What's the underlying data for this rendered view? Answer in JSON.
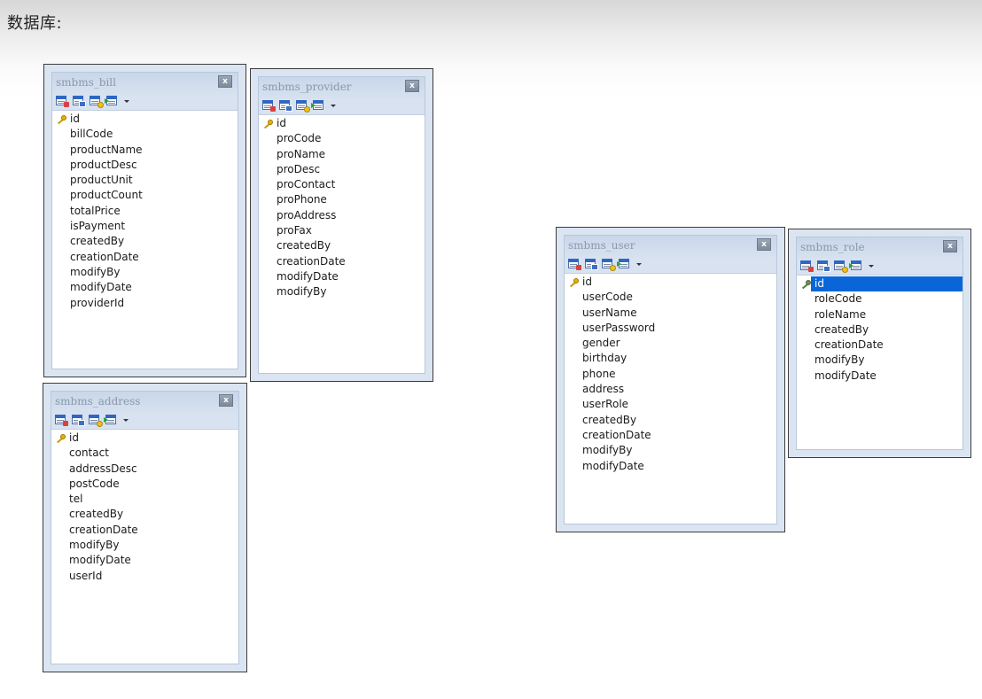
{
  "page": {
    "heading": "数据库:"
  },
  "tables": [
    {
      "name": "smbms_bill",
      "close_label": "x",
      "fields": [
        "id",
        "billCode",
        "productName",
        "productDesc",
        "productUnit",
        "productCount",
        "totalPrice",
        "isPayment",
        "createdBy",
        "creationDate",
        "modifyBy",
        "modifyDate",
        "providerId"
      ],
      "primary_key": "id",
      "selected_field": null
    },
    {
      "name": "smbms_provider",
      "close_label": "x",
      "fields": [
        "id",
        "proCode",
        "proName",
        "proDesc",
        "proContact",
        "proPhone",
        "proAddress",
        "proFax",
        "createdBy",
        "creationDate",
        "modifyDate",
        "modifyBy"
      ],
      "primary_key": "id",
      "selected_field": null
    },
    {
      "name": "smbms_address",
      "close_label": "x",
      "fields": [
        "id",
        "contact",
        "addressDesc",
        "postCode",
        "tel",
        "createdBy",
        "creationDate",
        "modifyBy",
        "modifyDate",
        "userId"
      ],
      "primary_key": "id",
      "selected_field": null
    },
    {
      "name": "smbms_user",
      "close_label": "x",
      "fields": [
        "id",
        "userCode",
        "userName",
        "userPassword",
        "gender",
        "birthday",
        "phone",
        "address",
        "userRole",
        "createdBy",
        "creationDate",
        "modifyBy",
        "modifyDate"
      ],
      "primary_key": "id",
      "selected_field": null
    },
    {
      "name": "smbms_role",
      "close_label": "x",
      "fields": [
        "id",
        "roleCode",
        "roleName",
        "createdBy",
        "creationDate",
        "modifyBy",
        "modifyDate"
      ],
      "primary_key": "id",
      "selected_field": "id"
    }
  ],
  "toolbar_icons": [
    "table-add-icon",
    "table-remove-icon",
    "key-toggle-icon",
    "import-icon",
    "dropdown-arrow-icon"
  ],
  "colors": {
    "selection": "#0a66d8",
    "panel_background": "#dbe5f2",
    "title_text": "#8a98ac"
  }
}
